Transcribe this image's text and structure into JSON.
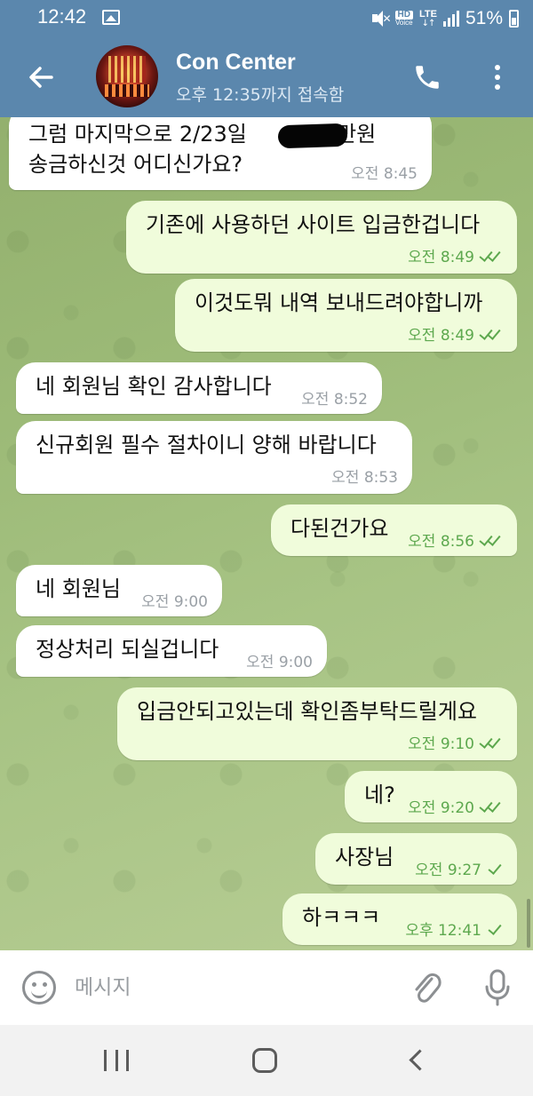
{
  "status_bar": {
    "time": "12:42",
    "network": "LTE",
    "hd": "HD",
    "voice": "Voice",
    "battery": "51%"
  },
  "header": {
    "name": "Con Center",
    "status": "오후 12:35까지 접속함"
  },
  "messages": [
    {
      "dir": "in",
      "text_line1": "그럼 마지막으로 2/23일",
      "text_line1_tail": "0만원",
      "text_line2": "송금하신것 어디신가요?",
      "time": "오전 8:45"
    },
    {
      "dir": "out",
      "text": "기존에 사용하던 사이트 입금한겁니다",
      "time": "오전 8:49",
      "checks": "double"
    },
    {
      "dir": "out",
      "text": "이것도뭐 내역 보내드려야합니까",
      "time": "오전 8:49",
      "checks": "double"
    },
    {
      "dir": "in",
      "text": "네 회원님 확인 감사합니다",
      "time": "오전 8:52"
    },
    {
      "dir": "in",
      "text": "신규회원 필수 절차이니 양해 바랍니다",
      "time": "오전 8:53"
    },
    {
      "dir": "out",
      "text": "다된건가요",
      "time": "오전 8:56",
      "checks": "double"
    },
    {
      "dir": "in",
      "text": "네 회원님",
      "time": "오전 9:00"
    },
    {
      "dir": "in",
      "text": "정상처리 되실겁니다",
      "time": "오전 9:00"
    },
    {
      "dir": "out",
      "text": "입금안되고있는데 확인좀부탁드릴게요",
      "time": "오전 9:10",
      "checks": "double"
    },
    {
      "dir": "out",
      "text": "네?",
      "time": "오전 9:20",
      "checks": "double"
    },
    {
      "dir": "out",
      "text": "사장님",
      "time": "오전 9:27",
      "checks": "single"
    },
    {
      "dir": "out",
      "text": "하ㅋㅋㅋ",
      "time": "오후 12:41",
      "checks": "single"
    }
  ],
  "composer": {
    "placeholder": "메시지"
  },
  "icons": {
    "back": "back-arrow-icon",
    "call": "phone-icon",
    "menu": "more-vert-icon",
    "emoji": "emoji-icon",
    "attach": "paperclip-icon",
    "mic": "microphone-icon",
    "nav_recents": "recents-icon",
    "nav_home": "home-icon",
    "nav_back": "back-chevron-icon"
  },
  "colors": {
    "header": "#5b87ad",
    "incoming_bubble": "#ffffff",
    "outgoing_bubble": "#f0fcdb",
    "read_check": "#5da84e",
    "wallpaper": "#9cba77"
  }
}
